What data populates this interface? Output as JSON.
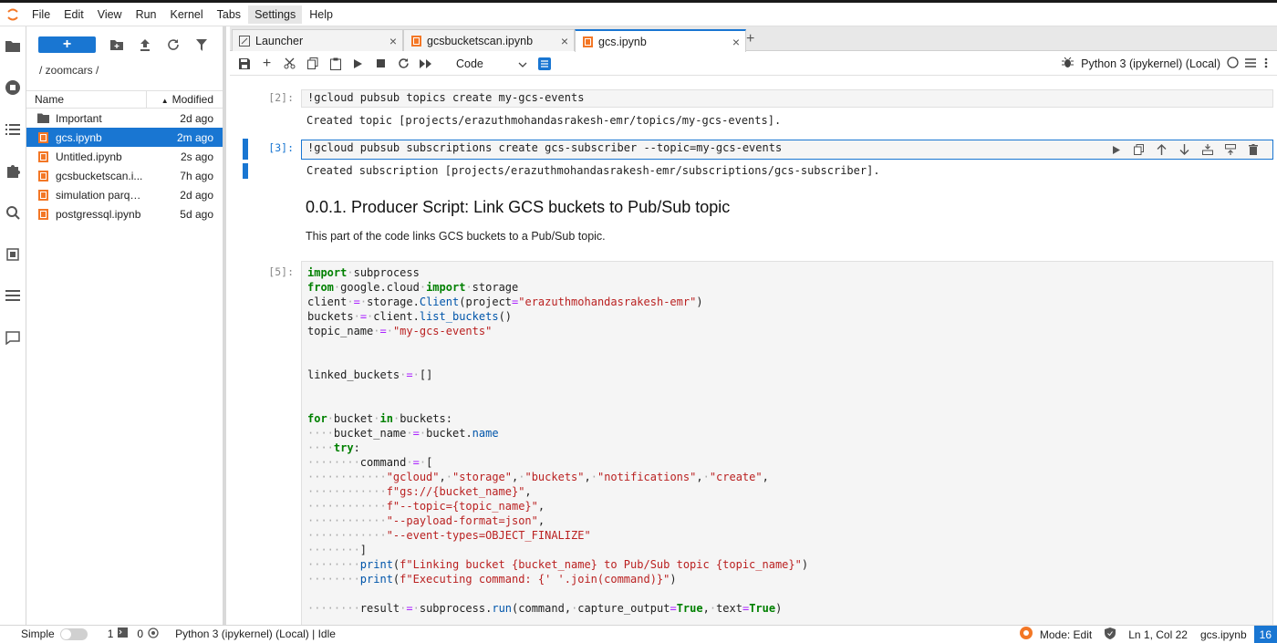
{
  "menu": [
    "File",
    "Edit",
    "View",
    "Run",
    "Kernel",
    "Tabs",
    "Settings",
    "Help"
  ],
  "menu_active": "Settings",
  "filebrowser": {
    "new_label": "+",
    "breadcrumb": "/ zoomcars /",
    "col_name": "Name",
    "col_modified": "Modified",
    "files": [
      {
        "name": "Important",
        "modified": "2d ago",
        "type": "folder"
      },
      {
        "name": "gcs.ipynb",
        "modified": "2m ago",
        "type": "notebook"
      },
      {
        "name": "Untitled.ipynb",
        "modified": "2s ago",
        "type": "notebook"
      },
      {
        "name": "gcsbucketscan.i...",
        "modified": "7h ago",
        "type": "notebook"
      },
      {
        "name": "simulation parqu...",
        "modified": "2d ago",
        "type": "notebook"
      },
      {
        "name": "postgressql.ipynb",
        "modified": "5d ago",
        "type": "notebook"
      }
    ]
  },
  "tabs": [
    {
      "label": "Launcher",
      "icon": "launcher-icon"
    },
    {
      "label": "gcsbucketscan.ipynb",
      "icon": "notebook-icon"
    },
    {
      "label": "gcs.ipynb",
      "icon": "notebook-icon"
    }
  ],
  "toolbar": {
    "cell_type": "Code",
    "kernel_name": "Python 3 (ipykernel) (Local)"
  },
  "cells": {
    "c1_prompt": "[2]:",
    "c1_input": "!gcloud pubsub topics create my-gcs-events",
    "c1_output": "Created topic [projects/erazuthmohandasrakesh-emr/topics/my-gcs-events].",
    "c2_prompt": "[3]:",
    "c2_input": "!gcloud pubsub subscriptions create gcs-subscriber --topic=my-gcs-events",
    "c2_output": "Created subscription [projects/erazuthmohandasrakesh-emr/subscriptions/gcs-subscriber].",
    "md_heading": "0.0.1. Producer Script: Link GCS buckets to Pub/Sub topic",
    "md_text": "This part of the code links GCS buckets to a Pub/Sub topic.",
    "c3_prompt": "[5]:"
  },
  "code_lines": [
    "import subprocess",
    "from google.cloud import storage",
    "client = storage.Client(project=\"erazuthmohandasrakesh-emr\")",
    "buckets = client.list_buckets()",
    "topic_name = \"my-gcs-events\"",
    "",
    "",
    "linked_buckets = []",
    "",
    "",
    "for bucket in buckets:",
    "    bucket_name = bucket.name",
    "    try:",
    "        command = [",
    "            \"gcloud\", \"storage\", \"buckets\", \"notifications\", \"create\",",
    "            f\"gs://{bucket_name}\",",
    "            f\"--topic={topic_name}\",",
    "            \"--payload-format=json\",",
    "            \"--event-types=OBJECT_FINALIZE\"",
    "        ]",
    "        print(f\"Linking bucket {bucket_name} to Pub/Sub topic {topic_name}\")",
    "        print(f\"Executing command: {' '.join(command)}\")",
    "",
    "        result = subprocess.run(command, capture_output=True, text=True)"
  ],
  "status": {
    "mode_label": "Simple",
    "terminals": "1",
    "kernels": "0",
    "kernel_status": "Python 3 (ipykernel) (Local) | Idle",
    "edit_mode": "Mode: Edit",
    "cursor": "Ln 1, Col 22",
    "filename": "gcs.ipynb",
    "badge": "16"
  },
  "colors": {
    "accent": "#1976d2",
    "notebook_orange": "#f37726"
  }
}
